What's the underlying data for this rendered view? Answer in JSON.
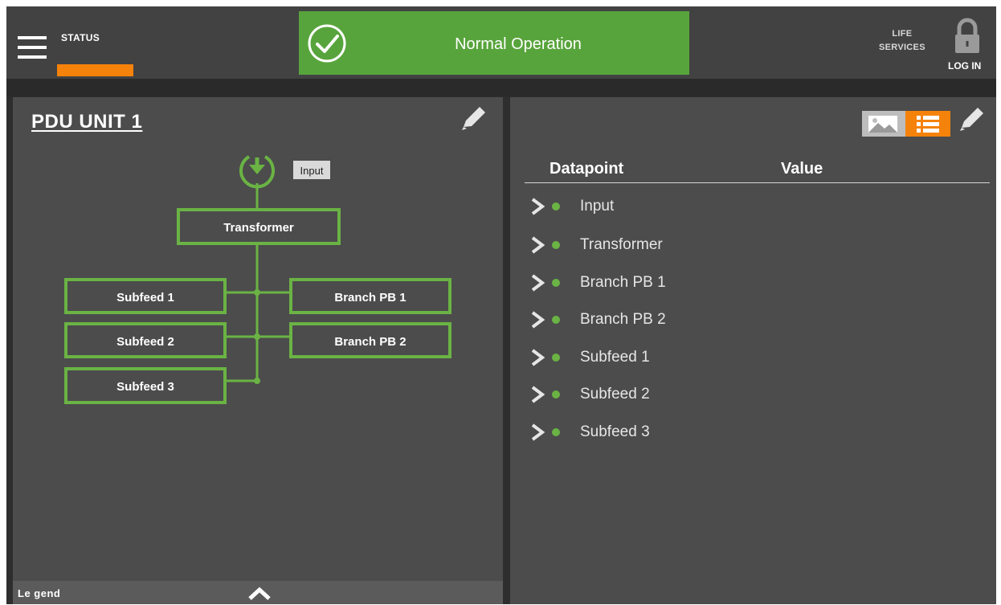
{
  "header": {
    "nav_tab": "STATUS",
    "banner_text": "Normal Operation",
    "life_services_line1": "LIFE",
    "life_services_line2": "SERVICES",
    "login_label": "LOG IN"
  },
  "left_panel": {
    "title": "PDU UNIT 1",
    "diagram": {
      "input_label": "Input",
      "transformer": "Transformer",
      "subfeed_1": "Subfeed 1",
      "subfeed_2": "Subfeed 2",
      "subfeed_3": "Subfeed 3",
      "branch_1": "Branch PB 1",
      "branch_2": "Branch PB 2"
    },
    "legend_label": "Le gend"
  },
  "right_panel": {
    "columns": [
      "Datapoint",
      "Value"
    ],
    "datapoints": [
      {
        "label": "Input"
      },
      {
        "label": "Transformer"
      },
      {
        "label": "Branch PB 1"
      },
      {
        "label": "Branch PB 2"
      },
      {
        "label": "Subfeed 1"
      },
      {
        "label": "Subfeed 2"
      },
      {
        "label": "Subfeed 3"
      }
    ]
  },
  "colors": {
    "accent_orange": "#f5820b",
    "ok_green": "#58a43c",
    "diagram_green": "#6ab344",
    "panel_bg": "#4c4c4c"
  }
}
